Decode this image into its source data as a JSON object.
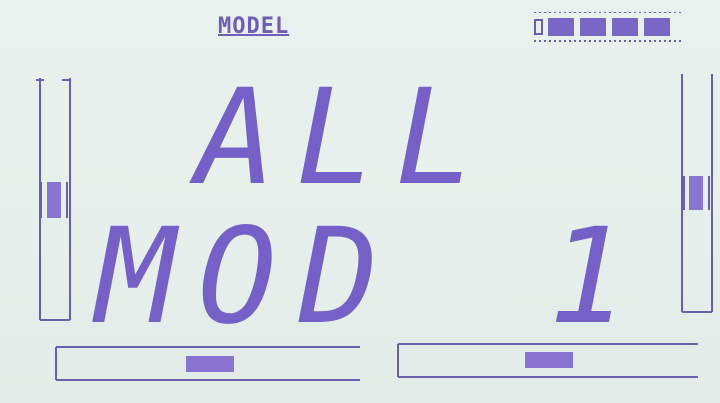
{
  "header": {
    "mode_label": "MODEL"
  },
  "battery": {
    "segments": 4,
    "level": 1.0
  },
  "display": {
    "line1": "ALL",
    "line2_left": "MOD",
    "line2_right": "1"
  },
  "trims": {
    "left_vertical": {
      "position": 0.55
    },
    "right_vertical": {
      "position": 0.5
    },
    "left_horizontal": {
      "position": 0.5
    },
    "right_horizontal": {
      "position": 0.45
    }
  },
  "colors": {
    "lcd_bg": "#e7efec",
    "segment": "#7a66c6"
  }
}
